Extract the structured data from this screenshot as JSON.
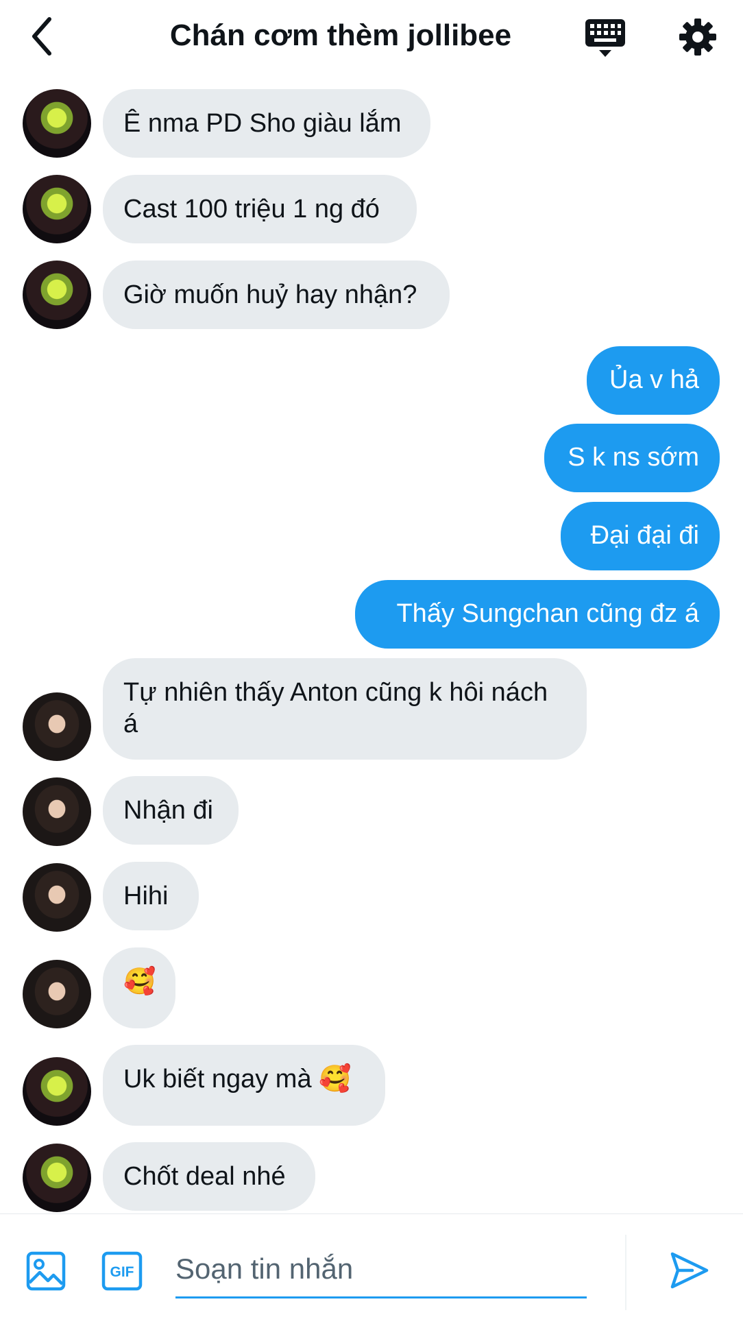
{
  "header": {
    "title": "Chán cơm thèm jollibee",
    "back_icon": "chevron-left-icon",
    "keyboard_icon": "keyboard-icon",
    "settings_icon": "gear-icon"
  },
  "messages": [
    {
      "side": "in",
      "avatar": "avatar-1",
      "text": "Ê nma PD Sho giàu lắm"
    },
    {
      "side": "in",
      "avatar": "avatar-1",
      "text": "Cast 100 triệu 1 ng đó"
    },
    {
      "side": "in",
      "avatar": "avatar-1",
      "text": "Giờ muốn huỷ hay nhận?"
    },
    {
      "side": "out",
      "text": "Ủa v hả"
    },
    {
      "side": "out",
      "text": "S k ns sớm"
    },
    {
      "side": "out",
      "text": "Đại đại đi"
    },
    {
      "side": "out",
      "text": "Thấy Sungchan cũng đz á"
    },
    {
      "side": "in",
      "avatar": "avatar-2",
      "text": "Tự nhiên thấy Anton cũng k hôi nách á"
    },
    {
      "side": "in",
      "avatar": "avatar-2",
      "text": "Nhận đi"
    },
    {
      "side": "in",
      "avatar": "avatar-2",
      "text": "Hihi"
    },
    {
      "side": "in",
      "avatar": "avatar-2",
      "text": "🥰"
    },
    {
      "side": "in",
      "avatar": "avatar-1",
      "text": "Uk biết ngay mà 🥰"
    },
    {
      "side": "in",
      "avatar": "avatar-1",
      "text": "Chốt deal nhé"
    }
  ],
  "composer": {
    "placeholder": "Soạn tin nhắn",
    "media_icon": "image-icon",
    "gif_label": "GIF",
    "send_icon": "send-icon"
  },
  "colors": {
    "accent": "#1d9bf0",
    "incoming_bubble": "#e7ebee",
    "text": "#0f1419"
  }
}
